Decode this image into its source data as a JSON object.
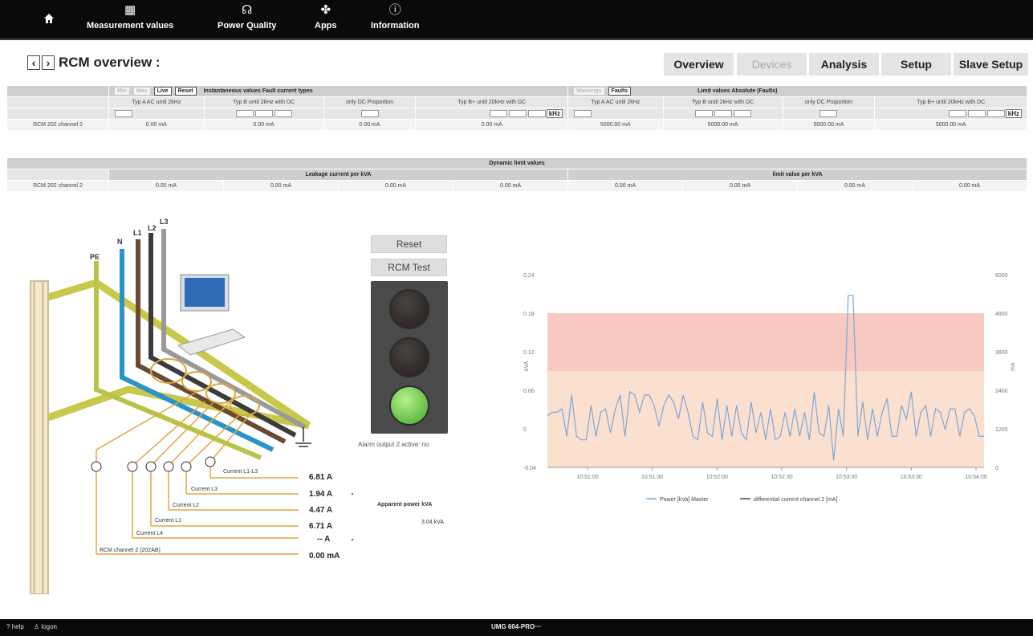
{
  "topnav": {
    "items": [
      {
        "label": "Measurement values",
        "icon": "grid-icon"
      },
      {
        "label": "Power Quality",
        "icon": "plug-icon"
      },
      {
        "label": "Apps",
        "icon": "apps-icon"
      },
      {
        "label": "Information",
        "icon": "info-icon"
      }
    ]
  },
  "header": {
    "title": "RCM overview :",
    "tabs": [
      "Overview",
      "Devices",
      "Analysis",
      "Setup",
      "Slave Setup"
    ]
  },
  "table1": {
    "btn_min": "Min",
    "btn_max": "Max",
    "btn_live": "Live",
    "btn_reset": "Reset",
    "title_left": "Instantaneous values Fault current types",
    "btn_warnings": "Warnings",
    "btn_faults": "Faults",
    "title_right": "Limit values Absolute (Faults)",
    "col_left": [
      "Typ A AC until 2kHz",
      "Typ B until 2kHz with DC",
      "only DC Proportion",
      "Typ B+ until 20kHz with DC"
    ],
    "col_right": [
      "Typ A AC until 2kHz",
      "Typ B until 2kHz with DC",
      "only DC Proportion",
      "Typ B+ until 20kHz with DC"
    ],
    "khz": "kHz",
    "row_label": "RCM 202 channel 2",
    "values_left": [
      "0.00 mA",
      "0.00 mA",
      "0.00 mA",
      "0.00 mA"
    ],
    "values_right": [
      "5000.00 mA",
      "5000.00 mA",
      "5000.00 mA",
      "5000.00 mA"
    ]
  },
  "table2": {
    "title": "Dynamic limit values",
    "left_header": "Leakage current per kVA",
    "right_header": "limit value per kVA",
    "row_label": "RCM 202 channel 2",
    "values_left": [
      "0.00 mA",
      "0.00 mA",
      "0.00 mA",
      "0.00 mA"
    ],
    "values_right": [
      "0.00 mA",
      "0.00 mA",
      "0.00 mA",
      "0.00 mA"
    ]
  },
  "diagram": {
    "wire_labels": [
      "PE",
      "N",
      "L1",
      "L2",
      "L3"
    ],
    "current_labels": [
      "Current L1-L3",
      "Current L3",
      "Current L2",
      "Current L1",
      "Current L4",
      "RCM channel 2 (202AB)"
    ],
    "readings": [
      "6.81 A",
      "1.94 A",
      "4.47 A",
      "6.71 A",
      "-- A",
      "0.00 mA"
    ],
    "apparent_label": "Apparent power kVA",
    "apparent_value": "3.04 kVA"
  },
  "controls": {
    "reset": "Reset",
    "rcm_test": "RCM Test",
    "alarm": "Alarm output 2 active: no",
    "lamp_states": [
      "off",
      "off",
      "green"
    ]
  },
  "chart_data": {
    "type": "line",
    "y_left": {
      "label": "kVA",
      "ticks": [
        "0.24",
        "0.18",
        "0.12",
        "0.06",
        "0",
        "-0.04"
      ]
    },
    "y_right": {
      "label": "mA",
      "ticks": [
        "6000",
        "4800",
        "3600",
        "2400",
        "1200",
        "0"
      ]
    },
    "x_ticks": [
      "10:51:00",
      "10:51:30",
      "10:52:00",
      "10:52:30",
      "10:53:00",
      "10:53:30",
      "10:54:00"
    ],
    "bands": [
      {
        "from": 3000,
        "to": 4800,
        "color": "#f8c9c0"
      },
      {
        "from": 0,
        "to": 3000,
        "color": "#fbe0d0"
      }
    ],
    "series": [
      {
        "name": "Power [kVa] Master",
        "color": "#7aa7d8",
        "values": [
          0.035,
          0.04,
          0.04,
          0.045,
          0.005,
          0.065,
          0.005,
          0,
          0.0,
          0.05,
          0.005,
          0.04,
          0.045,
          0.01,
          0.045,
          0.065,
          0.005,
          0.07,
          0.065,
          0.04,
          0.065,
          0.065,
          0.05,
          0.02,
          0.05,
          0.065,
          0.055,
          0.03,
          0.065,
          0.04,
          0.005,
          0.0,
          0.055,
          0.01,
          0.005,
          0.06,
          0.0,
          0.05,
          0.005,
          0.05,
          0.01,
          0.0,
          0.055,
          0.01,
          0.04,
          0.0,
          0.045,
          0.0,
          0.005,
          0.04,
          0.005,
          0.045,
          0.005,
          0.04,
          0.0,
          0.07,
          0.01,
          0.005,
          0.05,
          -0.03,
          0.045,
          0.005,
          0.21,
          0.21,
          0.005,
          0.055,
          0.0,
          0.045,
          0.005,
          0.04,
          0.06,
          0.005,
          0.005,
          0.05,
          0.03,
          0.07,
          0.005,
          0.04,
          0.05,
          0.005,
          0.045,
          0.04,
          0.015,
          0.045,
          0.045,
          0.005,
          0.04,
          0.045,
          0.035,
          0.005,
          0.005
        ]
      },
      {
        "name": "differential current channel 2 [mA]",
        "color": "#444444",
        "values": [
          0
        ]
      }
    ]
  }
}
